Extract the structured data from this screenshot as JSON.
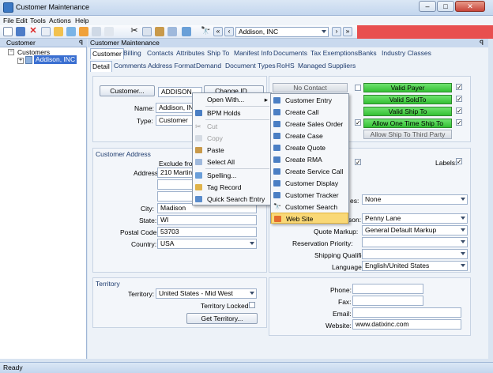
{
  "window": {
    "title": "Customer Maintenance",
    "minimize": "–",
    "maximize": "□",
    "close": "✕"
  },
  "menu": [
    "File",
    "Edit",
    "Tools",
    "Actions",
    "Help"
  ],
  "toolbar": {
    "record_value": "Addison, INC"
  },
  "left_panel": {
    "header": "Customer",
    "pin": "ꟼ",
    "tree": {
      "root": "Customers",
      "child": "Addison, INC"
    }
  },
  "main": {
    "header": "Customer Maintenance",
    "pin": "ꟼ",
    "tabs_row1": [
      "Customer",
      "Billing",
      "Contacts",
      "Attributes",
      "Ship To",
      "Manifest Info",
      "Documents",
      "Tax Exemptions",
      "Banks",
      "Industry Classes"
    ],
    "tabs_row2": [
      "Detail",
      "Comments",
      "Address Format",
      "Demand",
      "Document Types",
      "RoHS",
      "Managed Suppliers"
    ],
    "customer_button": "Customer...",
    "customer_id": "ADDISON",
    "change_id_button": "Change ID...",
    "name_label": "Name:",
    "name_value": "Addison, INC",
    "type_label": "Type:",
    "type_value": "Customer",
    "no_contact": "No Contact",
    "status_buttons": [
      "Valid Payer",
      "Valid SoldTo",
      "Valid Ship To",
      "Allow One Time Ship To"
    ],
    "allow_third_party": "Allow Ship To Third Party",
    "address": {
      "title": "Customer Address",
      "exclude_label": "Exclude from",
      "address_label": "Address:",
      "address_line1": "210 Martin L",
      "city_label": "City:",
      "city": "Madison",
      "state_label": "State:",
      "state": "WI",
      "postal_label": "Postal Code:",
      "postal": "53703",
      "country_label": "Country:",
      "country": "USA"
    },
    "labels_label": "Labels:",
    "check_mark": "✓",
    "right_fields": {
      "partial_label1": "es:",
      "partial_value1": "None",
      "salesperson_label": "son:",
      "salesperson": "Penny Lane",
      "quote_markup_label": "Quote Markup:",
      "quote_markup": "General Default Markup",
      "reservation_label": "Reservation Priority:",
      "shipping_label": "Shipping Qualifie",
      "language_label": "Language:",
      "language": "English/United States"
    },
    "territory": {
      "title": "Territory",
      "territory_label": "Territory:",
      "territory_value": "United States - Mid West",
      "locked_label": "Territory Locked:",
      "get_button": "Get Territory..."
    },
    "contact": {
      "phone_label": "Phone:",
      "fax_label": "Fax:",
      "email_label": "Email:",
      "website_label": "Website:",
      "website": "www.datixinc.com"
    }
  },
  "context_menu": {
    "items": [
      "Open With...",
      "BPM Holds",
      "Cut",
      "Copy",
      "Paste",
      "Select All",
      "Spelling...",
      "Tag Record",
      "Quick Search Entry"
    ]
  },
  "submenu": {
    "items": [
      "Customer Entry",
      "Create Call",
      "Create Sales Order",
      "Create Case",
      "Create Quote",
      "Create RMA",
      "Create Service Call",
      "Customer Display",
      "Customer Tracker",
      "Customer Search",
      "Web Site"
    ]
  },
  "status": "Ready",
  "colors": {
    "accent": "#e84f4f",
    "green": "#34c034",
    "highlight": "#f9d876"
  }
}
